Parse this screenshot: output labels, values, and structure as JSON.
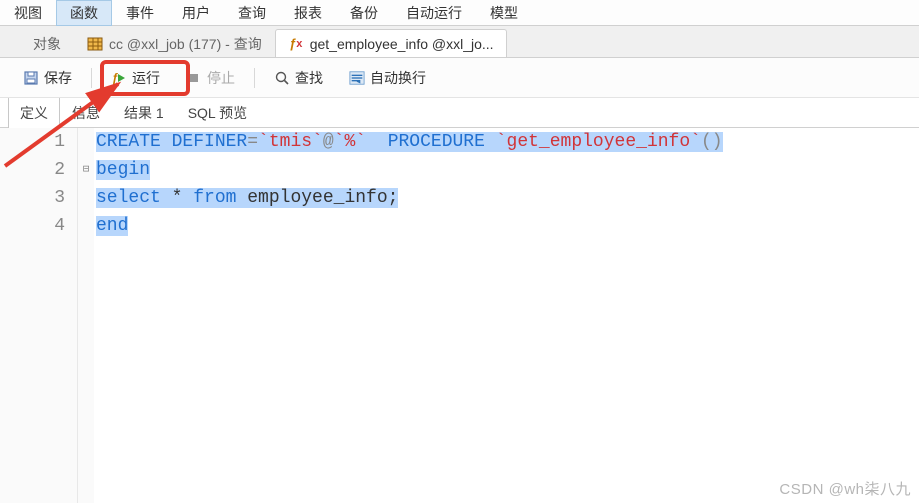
{
  "menubar": {
    "items": [
      "视图",
      "函数",
      "事件",
      "用户",
      "查询",
      "报表",
      "备份",
      "自动运行",
      "模型"
    ],
    "active": 1
  },
  "tabs": {
    "items": [
      {
        "label": "对象",
        "active": false
      },
      {
        "label": "cc @xxl_job (177) - 查询",
        "active": false,
        "icon": "table"
      },
      {
        "label": "get_employee_info @xxl_jo...",
        "active": true,
        "icon": "fx"
      }
    ]
  },
  "toolbar": {
    "save": "保存",
    "run": "运行",
    "stop": "停止",
    "find": "查找",
    "wrap": "自动换行"
  },
  "subtabs": {
    "items": [
      "定义",
      "信息",
      "结果 1",
      "SQL 预览"
    ],
    "active": 0
  },
  "code": {
    "lines": [
      {
        "n": "1",
        "tokens": [
          {
            "t": "CREATE DEFINER",
            "cls": "kw sel"
          },
          {
            "t": "=",
            "cls": "op sel"
          },
          {
            "t": "`tmis`",
            "cls": "str sel"
          },
          {
            "t": "@",
            "cls": "op sel"
          },
          {
            "t": "`%`",
            "cls": "str sel"
          },
          {
            "t": "  ",
            "cls": "sel"
          },
          {
            "t": "PROCEDURE",
            "cls": "kw sel"
          },
          {
            "t": " ",
            "cls": "sel"
          },
          {
            "t": "`get_employee_info`",
            "cls": "str sel"
          },
          {
            "t": "()",
            "cls": "op sel"
          }
        ]
      },
      {
        "n": "2",
        "fold": "⊟",
        "tokens": [
          {
            "t": "begin",
            "cls": "kw sel"
          }
        ]
      },
      {
        "n": "3",
        "tokens": [
          {
            "t": "select",
            "cls": "kw sel"
          },
          {
            "t": " * ",
            "cls": "ident sel"
          },
          {
            "t": "from",
            "cls": "kw sel"
          },
          {
            "t": " employee_info;",
            "cls": "ident sel"
          }
        ]
      },
      {
        "n": "4",
        "tokens": [
          {
            "t": "end",
            "cls": "kw sel"
          }
        ]
      }
    ]
  },
  "watermark": "CSDN @wh柒八九",
  "annotation": {
    "highlight_target": "run-button",
    "arrow_color": "#e33b2e"
  }
}
